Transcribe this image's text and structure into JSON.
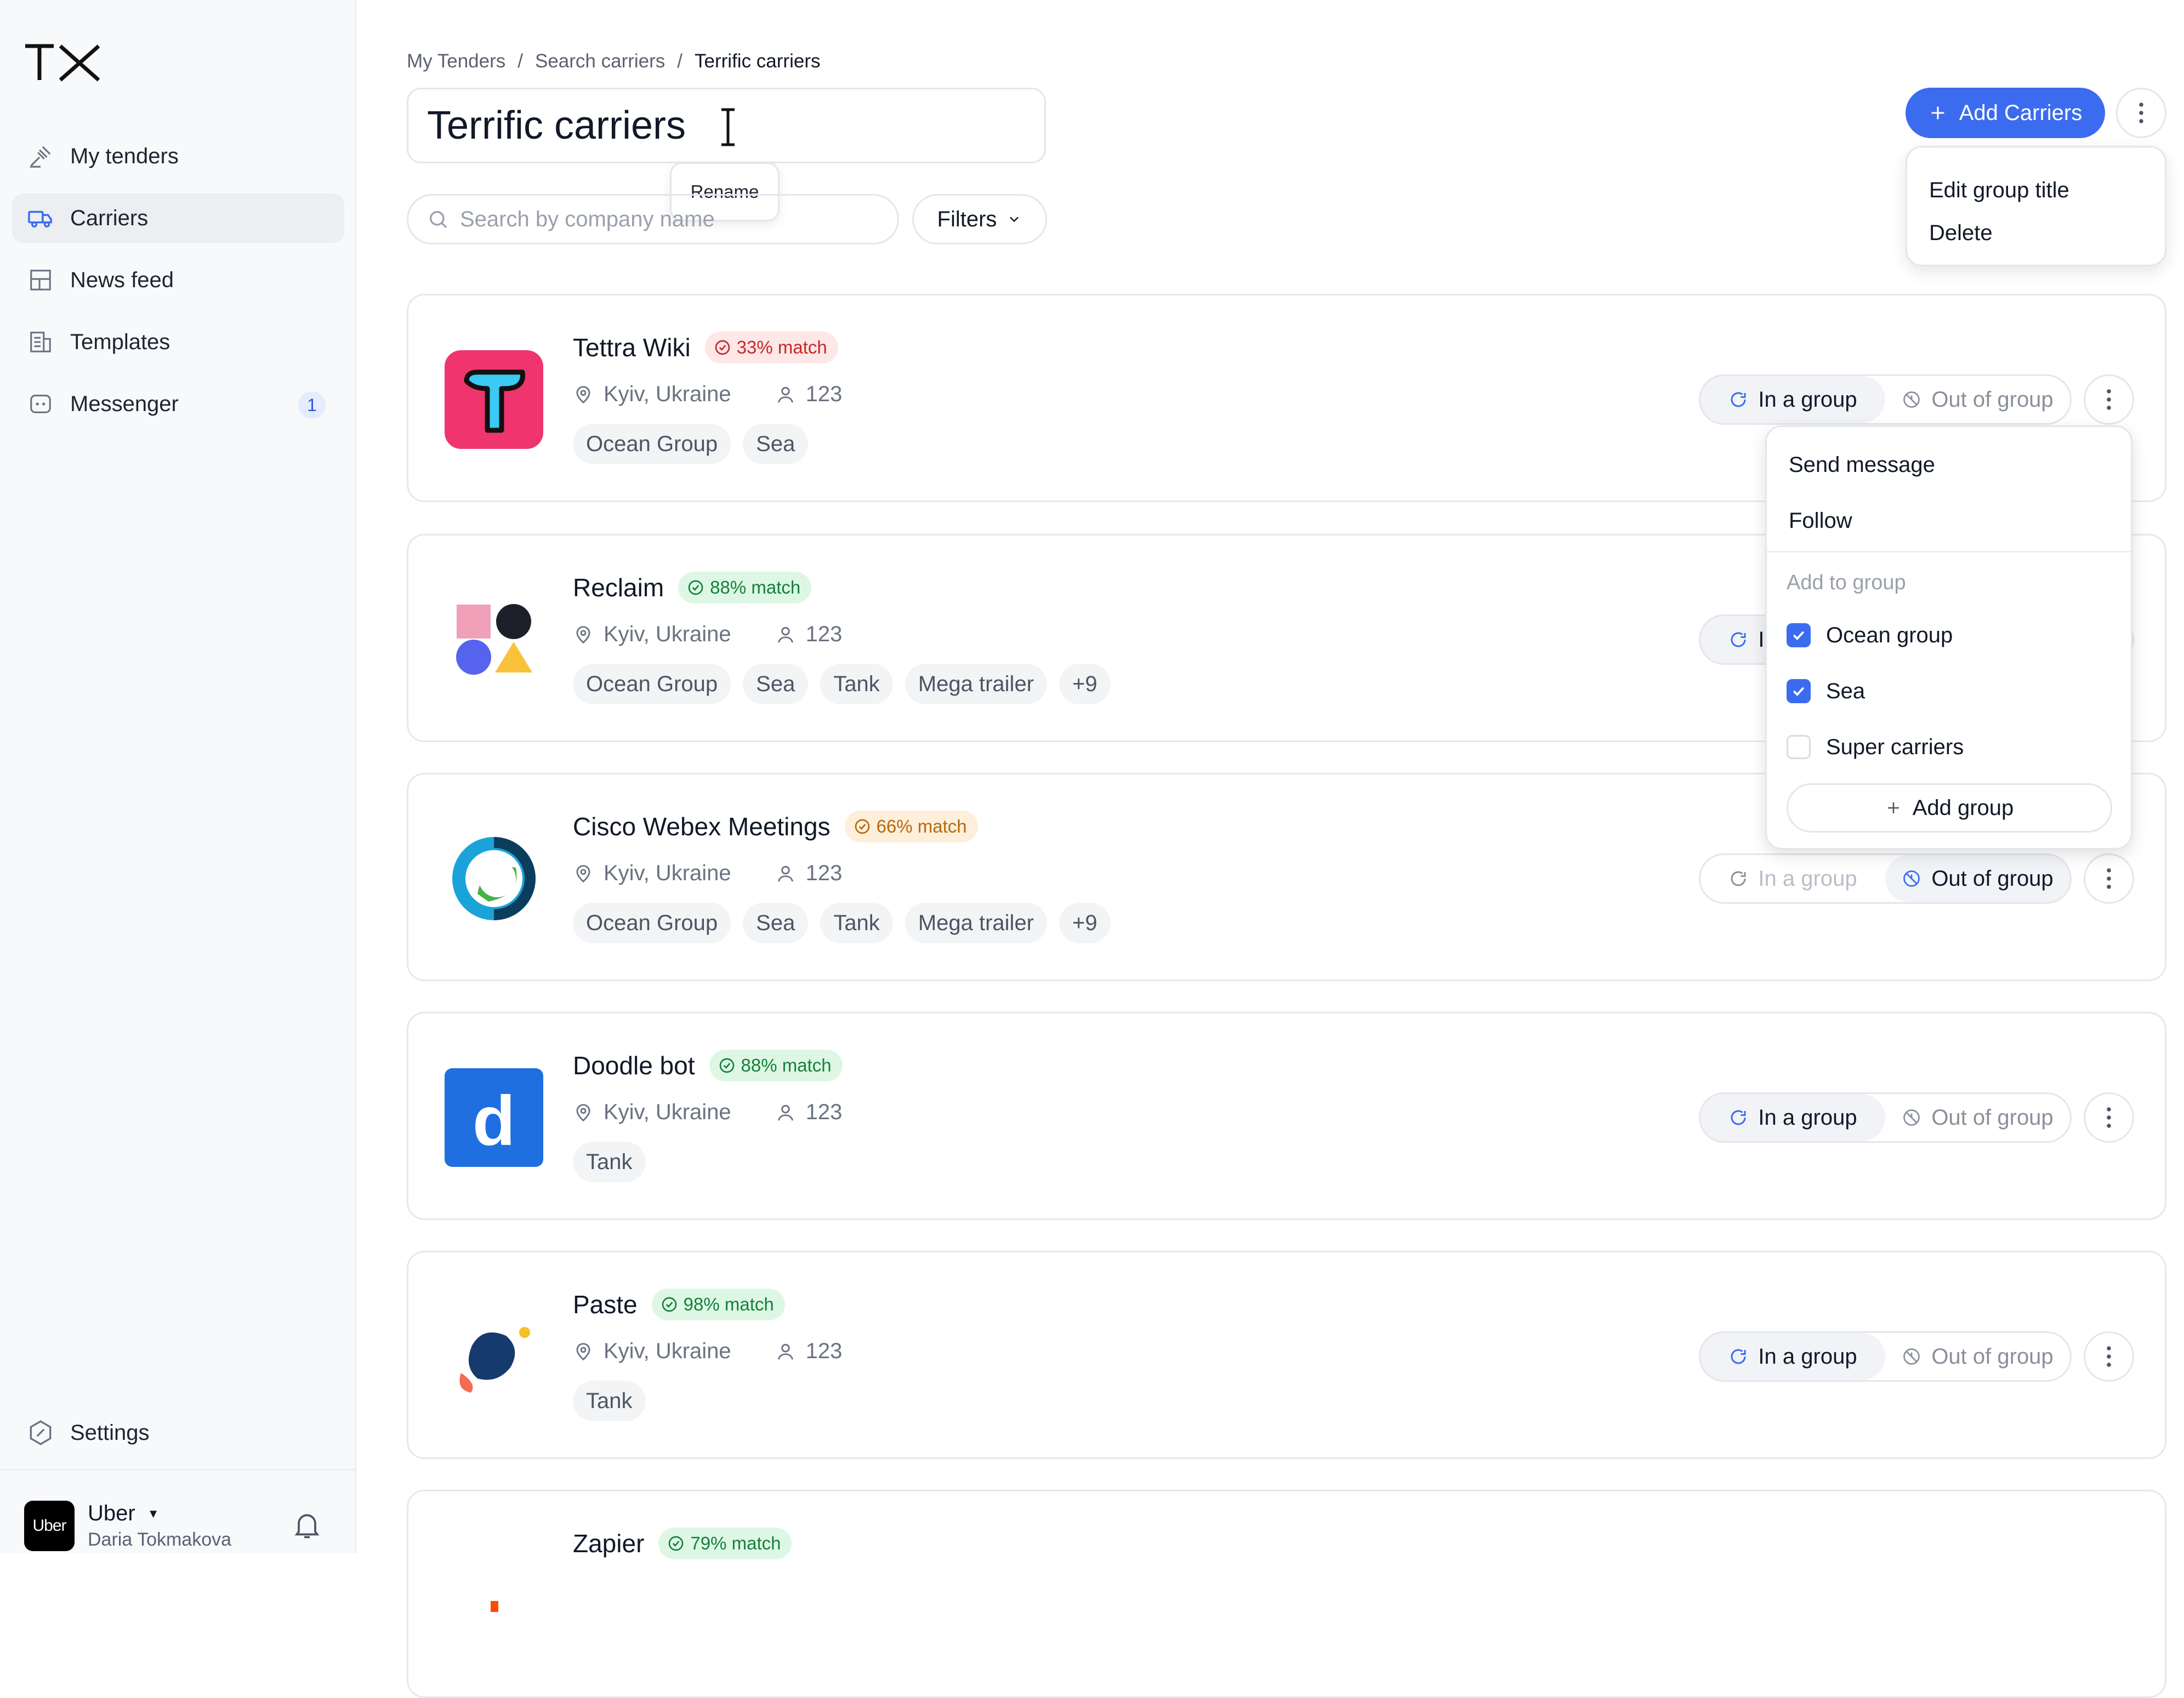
{
  "sidebar": {
    "logo": "TX",
    "items": [
      {
        "label": "My tenders",
        "icon": "gavel-icon"
      },
      {
        "label": "Carriers",
        "icon": "truck-icon",
        "active": true
      },
      {
        "label": "News feed",
        "icon": "layout-icon"
      },
      {
        "label": "Templates",
        "icon": "template-icon"
      },
      {
        "label": "Messenger",
        "icon": "chat-icon",
        "badge": "1"
      }
    ],
    "settings_label": "Settings",
    "account": {
      "avatar_text": "Uber",
      "company": "Uber",
      "user": "Daria Tokmakova"
    }
  },
  "header": {
    "breadcrumb": [
      "My Tenders",
      "/",
      "Search carriers",
      "/",
      "Terrific carriers"
    ],
    "title": "Terrific carriers",
    "rename_tooltip": "Rename",
    "search_placeholder": "Search by company name",
    "filters_label": "Filters",
    "add_carriers_label": "Add Carriers"
  },
  "group_menu": {
    "items": [
      "Edit group title",
      "Delete"
    ]
  },
  "carriers": [
    {
      "name": "Tettra Wiki",
      "match": "33% match",
      "match_color": "red",
      "location": "Kyiv, Ukraine",
      "count": "123",
      "tags": [
        "Ocean Group",
        "Sea"
      ],
      "state": "in"
    },
    {
      "name": "Reclaim",
      "match": "88% match",
      "match_color": "green",
      "location": "Kyiv, Ukraine",
      "count": "123",
      "tags": [
        "Ocean Group",
        "Sea",
        "Tank",
        "Mega trailer",
        "+9"
      ],
      "state": "in"
    },
    {
      "name": "Cisco Webex Meetings",
      "match": "66% match",
      "match_color": "orange",
      "location": "Kyiv, Ukraine",
      "count": "123",
      "tags": [
        "Ocean Group",
        "Sea",
        "Tank",
        "Mega trailer",
        "+9"
      ],
      "state": "out"
    },
    {
      "name": "Doodle bot",
      "match": "88% match",
      "match_color": "green",
      "location": "Kyiv, Ukraine",
      "count": "123",
      "tags": [
        "Tank"
      ],
      "state": "in"
    },
    {
      "name": "Paste",
      "match": "98% match",
      "match_color": "green",
      "location": "Kyiv, Ukraine",
      "count": "123",
      "tags": [
        "Tank"
      ],
      "state": "in"
    },
    {
      "name": "Zapier",
      "match": "79% match",
      "match_color": "green"
    }
  ],
  "toggle": {
    "in_label": "In a group",
    "out_label": "Out of group"
  },
  "row_menu": {
    "send_message": "Send message",
    "follow": "Follow",
    "section_label": "Add to group",
    "groups": [
      {
        "label": "Ocean group",
        "checked": true
      },
      {
        "label": "Sea",
        "checked": true
      },
      {
        "label": "Super carriers",
        "checked": false
      }
    ],
    "add_group_label": "Add group"
  },
  "colors": {
    "accent": "#3b6cf0",
    "sidebar_bg": "#f8f9fb",
    "border": "#e3e6ea"
  }
}
